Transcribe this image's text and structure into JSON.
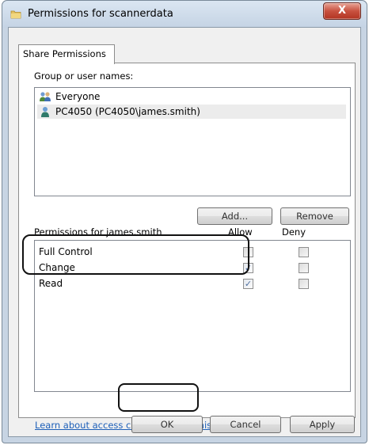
{
  "window": {
    "title": "Permissions for scannerdata",
    "close_glyph": "X"
  },
  "tab": {
    "label": "Share Permissions"
  },
  "users": {
    "label": "Group or user names:",
    "items": [
      {
        "name": "Everyone",
        "icon": "group-users-icon"
      },
      {
        "name": "PC4050 (PC4050\\james.smith)",
        "icon": "user-icon"
      }
    ],
    "add_label": "Add...",
    "remove_label": "Remove"
  },
  "permissions": {
    "label": "Permissions for  james.smith",
    "allow_header": "Allow",
    "deny_header": "Deny",
    "rows": [
      {
        "name": "Full Control",
        "allow": false,
        "deny": false
      },
      {
        "name": "Change",
        "allow": true,
        "deny": false
      },
      {
        "name": "Read",
        "allow": true,
        "deny": false
      }
    ]
  },
  "link": {
    "text": "Learn about access control and permissions"
  },
  "buttons": {
    "ok": "OK",
    "cancel": "Cancel",
    "apply": "Apply"
  },
  "check_glyph": "✓"
}
